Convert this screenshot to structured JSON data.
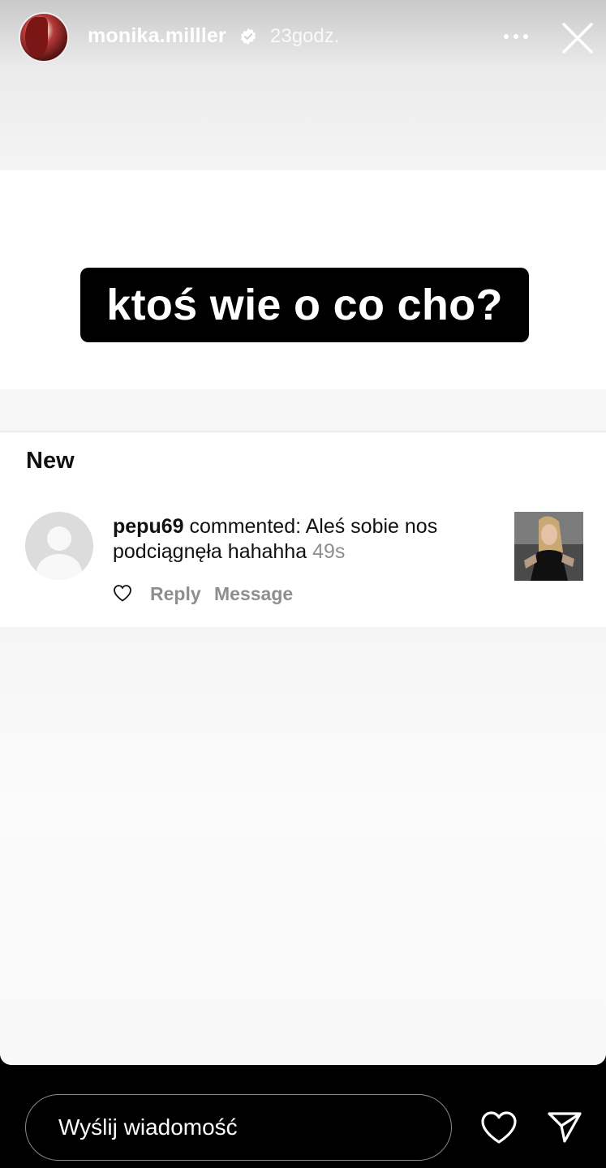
{
  "header": {
    "username": "monika.milller",
    "time": "23godz.",
    "icons": [
      "avatar",
      "verified-badge-icon",
      "more-icon",
      "close-icon"
    ]
  },
  "story": {
    "text": "ktoś wie o co cho?"
  },
  "activity": {
    "section_title": "New",
    "comment": {
      "username": "pepu69",
      "text": " commented: Aleś sobie nos podciągnęła hahahha ",
      "time": "49s",
      "reply_label": "Reply",
      "message_label": "Message"
    }
  },
  "footer": {
    "message_placeholder": "Wyślij wiadomość",
    "icons": [
      "heart-icon",
      "send-icon"
    ]
  },
  "colors": {
    "background": "#000000",
    "panel": "#ffffff",
    "muted_text": "#8e8e8e"
  }
}
